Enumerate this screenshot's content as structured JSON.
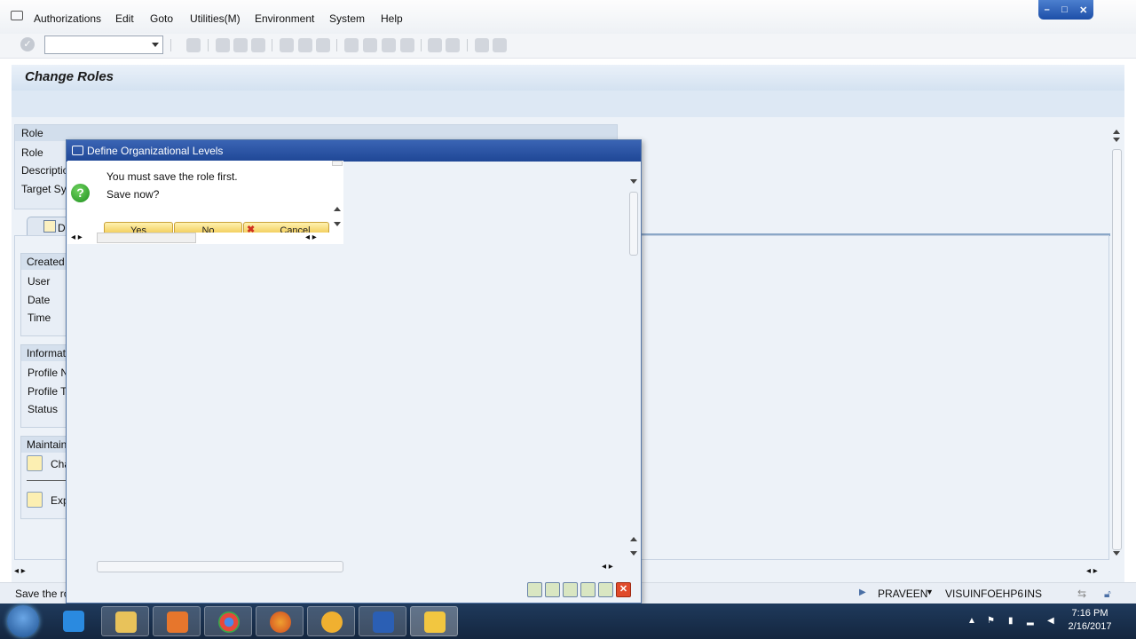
{
  "menu": [
    "Authorizations",
    "Edit",
    "Goto",
    "Utilities(M)",
    "Environment",
    "System",
    "Help"
  ],
  "window_controls": [
    "–",
    "□",
    "✕"
  ],
  "command_field": {
    "value": ""
  },
  "page_title": "Change Roles",
  "role_panel": {
    "header": "Role",
    "labels": [
      "Role",
      "Descriptio",
      "Target Sy"
    ]
  },
  "tabs": [
    {
      "label": "De"
    }
  ],
  "groups": {
    "created": {
      "header": "Created",
      "labels": [
        "User",
        "Date",
        "Time"
      ]
    },
    "information": {
      "header": "Informat",
      "labels": [
        "Profile N",
        "Profile T",
        "Status"
      ]
    },
    "maintain": {
      "header": "Maintain",
      "items": [
        "Cha",
        "Exp"
      ]
    }
  },
  "status": {
    "message": "Save the ro",
    "user": "PRAVEEN",
    "system": "VISUINFOEHP6",
    "mode": "INS"
  },
  "dialog": {
    "title": "Define Organizational Levels",
    "line1": "You must save the role first.",
    "line2": "Save now?",
    "buttons": {
      "yes": "Yes",
      "no": "No",
      "cancel": "Cancel"
    }
  },
  "taskbar": {
    "time": "7:16 PM",
    "date": "2/16/2017",
    "apps": [
      "ie",
      "file-explorer",
      "media-player",
      "chrome",
      "firefox",
      "asterisk-app",
      "word",
      "sap-logon"
    ]
  },
  "colors": {
    "title_blue": "#1f4796",
    "panel_bg": "#edf2f8",
    "button_yellow": "#f3d061",
    "taskbar": "#1f3a5c"
  }
}
